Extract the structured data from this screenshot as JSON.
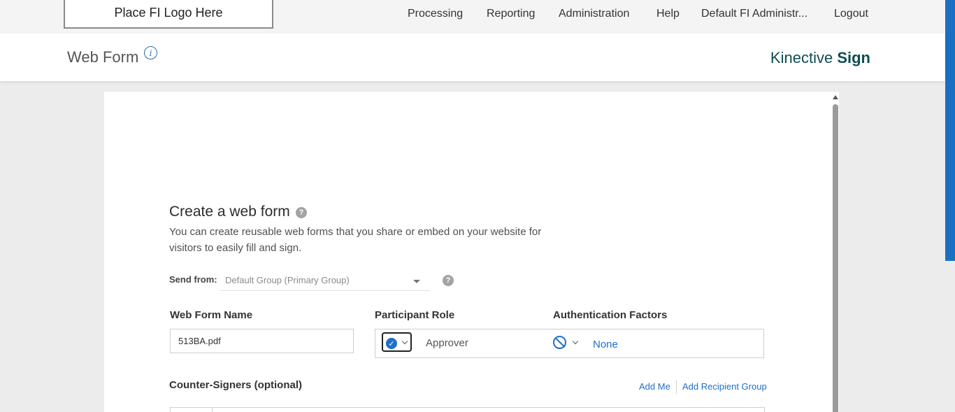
{
  "topbar": {
    "logo_text": "Place FI Logo Here",
    "nav": [
      "Processing",
      "Reporting",
      "Administration",
      "Help",
      "Default FI Administr...",
      "Logout"
    ]
  },
  "header": {
    "title": "Web Form",
    "brand_light": "Kinective",
    "brand_bold": "Sign"
  },
  "form": {
    "heading": "Create a web form",
    "description": "You can create reusable web forms that you share or embed on your website for visitors to easily fill and sign.",
    "send_from_label": "Send from:",
    "send_from_value": "Default Group (Primary Group)",
    "name_label": "Web Form Name",
    "name_value": "513BA.pdf",
    "role_label": "Participant Role",
    "role_value": "Approver",
    "auth_label": "Authentication Factors",
    "auth_value": "None",
    "counter_label": "Counter-Signers (optional)",
    "add_me": "Add Me",
    "add_group": "Add Recipient Group"
  },
  "colors": {
    "accent": "#1f6fc7",
    "brand": "#0f4d52",
    "edge_bar": "#1a6fc1"
  }
}
